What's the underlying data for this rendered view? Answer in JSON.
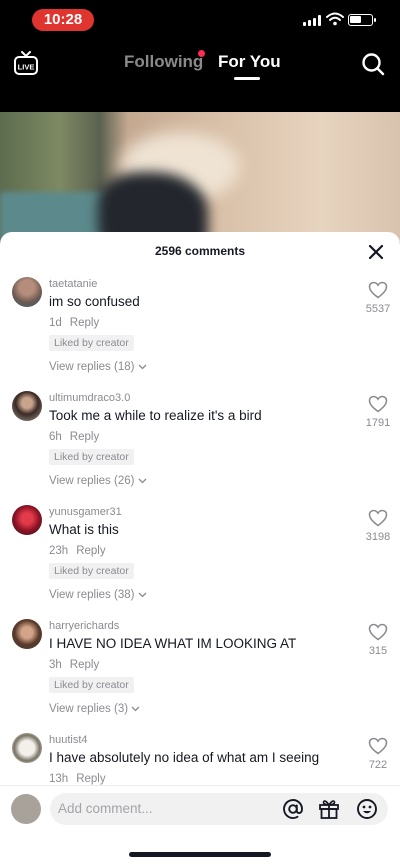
{
  "status": {
    "time": "10:28"
  },
  "nav": {
    "following": "Following",
    "for_you": "For You",
    "live_label": "LIVE"
  },
  "comments_header": {
    "count_label": "2596 comments"
  },
  "comments": [
    {
      "username": "taetatanie",
      "text": "im so confused",
      "age": "1d",
      "reply": "Reply",
      "liked_by": "Liked by creator",
      "view_replies": "View replies (18)",
      "likes": "5537"
    },
    {
      "username": "ultimumdraco3.0",
      "text": "Took me a while to realize it's a bird",
      "age": "6h",
      "reply": "Reply",
      "liked_by": "Liked by creator",
      "view_replies": "View replies (26)",
      "likes": "1791"
    },
    {
      "username": "yunusgamer31",
      "text": "What is this",
      "age": "23h",
      "reply": "Reply",
      "liked_by": "Liked by creator",
      "view_replies": "View replies (38)",
      "likes": "3198"
    },
    {
      "username": "harryerichards",
      "text": "I HAVE NO IDEA WHAT IM LOOKING AT",
      "age": "3h",
      "reply": "Reply",
      "liked_by": "Liked by creator",
      "view_replies": "View replies (3)",
      "likes": "315"
    },
    {
      "username": "huutist4",
      "text": "I have absolutely no idea of what am I seeing",
      "age": "13h",
      "reply": "Reply",
      "likes": "722"
    }
  ],
  "input": {
    "placeholder": "Add comment..."
  },
  "colors": {
    "accent": "#fe2c55",
    "status_pill": "#e0342f"
  },
  "icons": [
    "live-icon",
    "search-icon",
    "close-icon",
    "heart-icon",
    "chevron-down-icon",
    "at-icon",
    "gift-icon",
    "emoji-icon"
  ]
}
